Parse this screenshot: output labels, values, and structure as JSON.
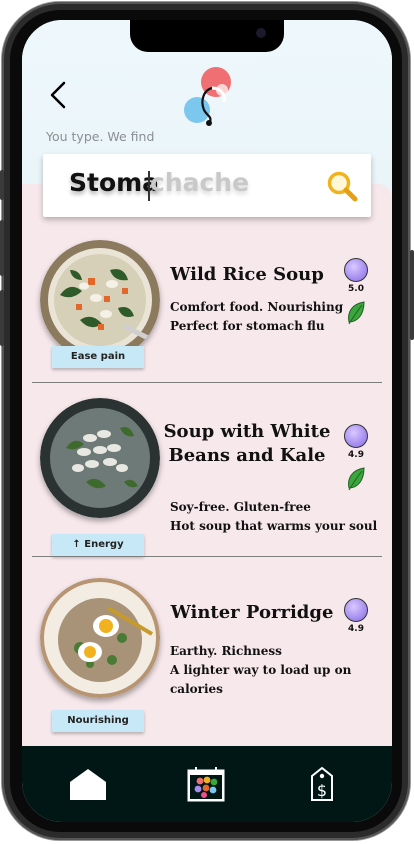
{
  "header": {
    "tagline": "You type. We find"
  },
  "search": {
    "typed_text": "Stoma",
    "autocomplete_text": "chache",
    "icon": "search-icon"
  },
  "recipes": [
    {
      "title_lines": [
        "Wild Rice Soup"
      ],
      "desc_lines": [
        "Comfort food. Nourishing",
        "Perfect for stomach flu"
      ],
      "tag": "Ease pain",
      "rating": "5.0",
      "vegan_icon": "leaf-icon"
    },
    {
      "title_lines": [
        "Soup with White",
        "Beans and Kale"
      ],
      "desc_lines": [
        "Soy-free. Gluten-free",
        "Hot soup that warms your soul"
      ],
      "tag": "↑ Energy",
      "rating": "4.9",
      "vegan_icon": "leaf-icon"
    },
    {
      "title_lines": [
        "Winter Porridge"
      ],
      "desc_lines": [
        "Earthy. Richness",
        "A lighter way to load up on calories"
      ],
      "tag": "Nourishing",
      "rating": "4.9"
    }
  ],
  "navbar": {
    "items": [
      "home-icon",
      "calendar-icon",
      "price-tag-icon"
    ]
  },
  "colors": {
    "accent_pink": "#f7e8ec",
    "tag_blue": "#c7e9f7",
    "rating_purple": "#a58ef0",
    "navbar": "#011716"
  }
}
